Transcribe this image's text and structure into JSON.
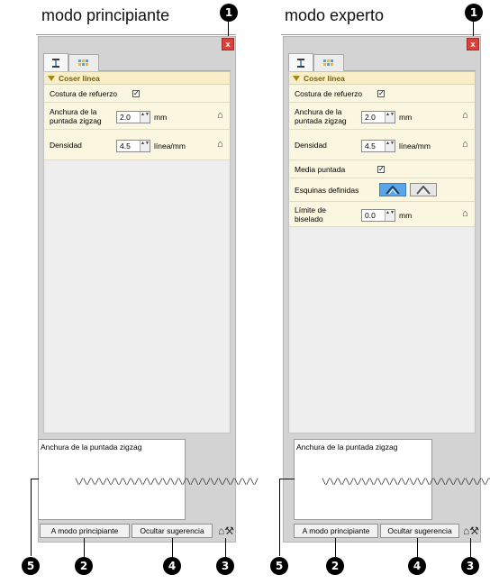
{
  "left": {
    "heading": "modo principiante",
    "section_title": "Coser línea",
    "rows": {
      "reinforce_label": "Costura de refuerzo",
      "reinforce_checked": true,
      "zigzag_label_1": "Anchura de la",
      "zigzag_label_2": "puntada zigzag",
      "zigzag_value": "2.0",
      "zigzag_unit": "mm",
      "density_label": "Densidad",
      "density_value": "4.5",
      "density_unit": "línea/mm"
    },
    "hint_title": "Anchura de la puntada zigzag",
    "hint_pattern": "\\/\\/\\/\\/\\/\\/\\/\\/\\/\\/\\/\\/\\/\\/\\/\\/\\/\\/\\/\\/\\/\\/\\/",
    "buttons": {
      "mode": "A modo principiante",
      "hide_hint": "Ocultar sugerencia"
    }
  },
  "right": {
    "heading": "modo experto",
    "section_title": "Coser línea",
    "rows": {
      "reinforce_label": "Costura de refuerzo",
      "reinforce_checked": true,
      "zigzag_label_1": "Anchura de la",
      "zigzag_label_2": "puntada zigzag",
      "zigzag_value": "2.0",
      "zigzag_unit": "mm",
      "density_label": "Densidad",
      "density_value": "4.5",
      "density_unit": "línea/mm",
      "half_stitch_label": "Media puntada",
      "half_stitch_checked": true,
      "corners_label": "Esquinas definidas",
      "bevel_label_1": "Límite de",
      "bevel_label_2": "biselado",
      "bevel_value": "0.0",
      "bevel_unit": "mm"
    },
    "hint_title": "Anchura de la puntada zigzag",
    "hint_pattern": "\\/\\/\\/\\/\\/\\/\\/\\/\\/\\/\\/\\/\\/\\/\\/\\/\\/\\/\\/\\/\\/\\/\\/",
    "buttons": {
      "mode": "A modo principiante",
      "hide_hint": "Ocultar sugerencia"
    }
  },
  "callouts": {
    "one": "1",
    "two": "2",
    "three": "3",
    "four": "4",
    "five": "5"
  },
  "glyphs": {
    "close": "x",
    "check": "✓",
    "spin": "▲▼"
  },
  "icons": {
    "default_value": "house-icon",
    "tools": "house-wrench-icon",
    "tab1": "stitch-tab-icon",
    "tab2": "color-tab-icon"
  },
  "colors": {
    "section_bg": "#fbf6df",
    "close_red": "#d9413a",
    "corner_active": "#5aa6e8"
  }
}
